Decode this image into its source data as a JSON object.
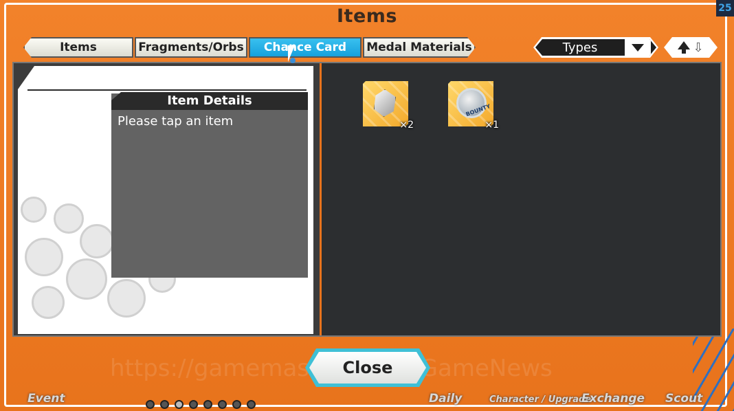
{
  "window": {
    "title": "Items",
    "fps": "25"
  },
  "tabs": [
    {
      "label": "Items",
      "active": false
    },
    {
      "label": "Fragments/Orbs",
      "active": false
    },
    {
      "label": "Chance Card",
      "active": true
    },
    {
      "label": "Medal Materials",
      "active": false
    }
  ],
  "filter": {
    "types_label": "Types"
  },
  "details": {
    "heading": "Item Details",
    "placeholder_text": "Please tap an item"
  },
  "items": [
    {
      "icon": "silver-gem-icon",
      "count": "×2"
    },
    {
      "icon": "bounty-medal-icon",
      "count": "×1",
      "medal_text": "BOUNTY"
    }
  ],
  "footer": {
    "close_label": "Close",
    "watermark": "https://gamemaster.caller/GameNews"
  },
  "nav": {
    "event": "Event",
    "daily": "Daily",
    "character": "Character / Upgrade",
    "exchange": "Exchange",
    "scout": "Scout"
  },
  "colors": {
    "frame_orange": "#e8731c",
    "active_tab": "#1aa6de",
    "item_gold": "#f3a92c",
    "panel_dark": "#2c2e30"
  }
}
